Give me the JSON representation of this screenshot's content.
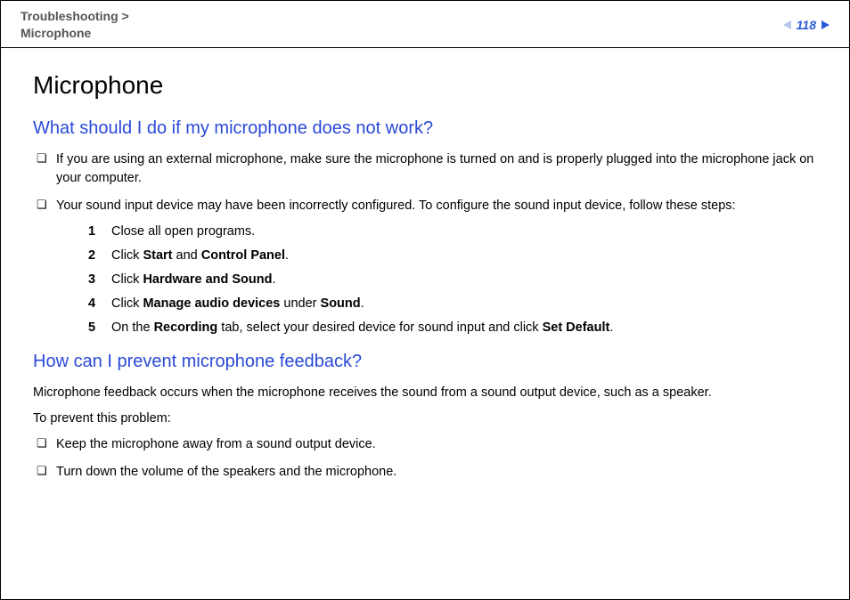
{
  "breadcrumb": {
    "line1": "Troubleshooting >",
    "line2": "Microphone"
  },
  "page_number": "118",
  "title": "Microphone",
  "sections": [
    {
      "heading": "What should I do if my microphone does not work?",
      "bullets": [
        {
          "text": "If you are using an external microphone, make sure the microphone is turned on and is properly plugged into the microphone jack on your computer."
        },
        {
          "text_html": "Your sound input device may have been incorrectly configured. To configure the sound input device, follow these steps:",
          "steps": [
            "Close all open programs.",
            "Click <b>Start</b> and <b>Control Panel</b>.",
            "Click <b>Hardware and Sound</b>.",
            "Click <b>Manage audio devices</b> under <b>Sound</b>.",
            "On the <b>Recording</b> tab, select your desired device for sound input and click <b>Set Default</b>."
          ]
        }
      ]
    },
    {
      "heading": "How can I prevent microphone feedback?",
      "paragraphs": [
        "Microphone feedback occurs when the microphone receives the sound from a sound output device, such as a speaker.",
        "To prevent this problem:"
      ],
      "bullets": [
        {
          "text": "Keep the microphone away from a sound output device."
        },
        {
          "text": "Turn down the volume of the speakers and the microphone."
        }
      ]
    }
  ]
}
